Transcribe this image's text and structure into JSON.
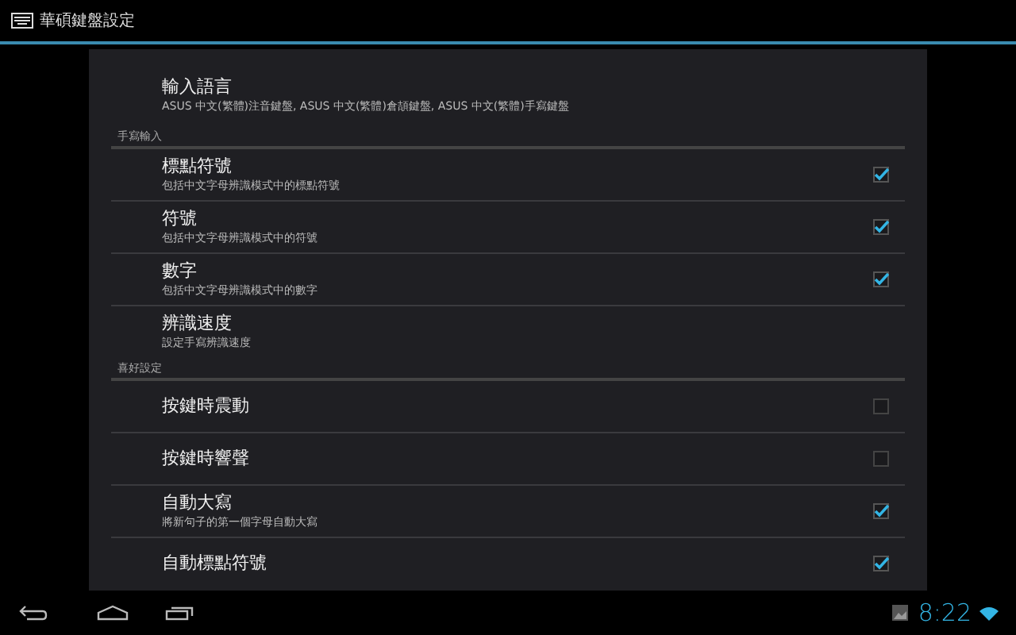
{
  "window": {
    "title": "華碩鍵盤設定"
  },
  "top_item": {
    "title": "輸入語言",
    "summary": "ASUS 中文(繁體)注音鍵盤, ASUS 中文(繁體)倉頡鍵盤, ASUS 中文(繁體)手寫鍵盤"
  },
  "sections": [
    {
      "header": "手寫輸入",
      "items": [
        {
          "kind": "checkbox",
          "title": "標點符號",
          "summary": "包括中文字母辨識模式中的標點符號",
          "checked": true
        },
        {
          "kind": "checkbox",
          "title": "符號",
          "summary": "包括中文字母辨識模式中的符號",
          "checked": true
        },
        {
          "kind": "checkbox",
          "title": "數字",
          "summary": "包括中文字母辨識模式中的數字",
          "checked": true
        },
        {
          "kind": "link",
          "title": "辨識速度",
          "summary": "設定手寫辨識速度"
        }
      ]
    },
    {
      "header": "喜好設定",
      "items": [
        {
          "kind": "checkbox",
          "title": "按鍵時震動",
          "checked": false
        },
        {
          "kind": "checkbox",
          "title": "按鍵時響聲",
          "checked": false
        },
        {
          "kind": "checkbox",
          "title": "自動大寫",
          "summary": "將新句子的第一個字母自動大寫",
          "checked": true
        },
        {
          "kind": "checkbox",
          "title": "自動標點符號",
          "checked": true
        }
      ]
    }
  ],
  "status_bar": {
    "time": "8:22"
  }
}
